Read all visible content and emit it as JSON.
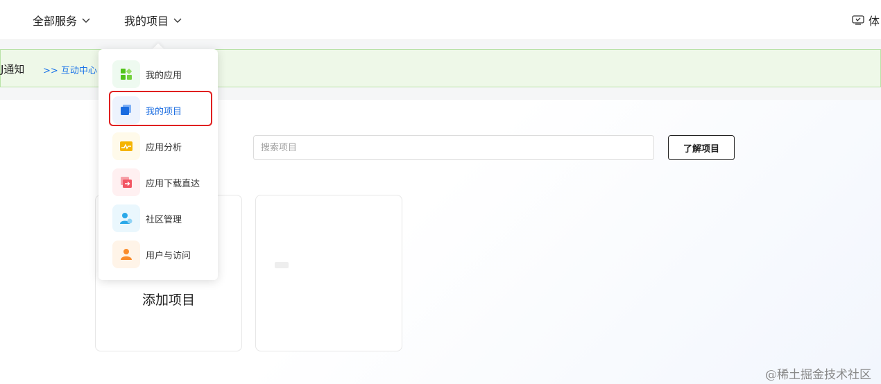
{
  "nav": {
    "all_services": "全部服务",
    "my_projects": "我的项目",
    "right_label": "体"
  },
  "notice": {
    "title": "J通知",
    "link": ">> 互动中心"
  },
  "search": {
    "placeholder": "搜索项目",
    "value": ""
  },
  "learn_button": "了解项目",
  "cards": {
    "add_label": "添加项目"
  },
  "dropdown": {
    "items": [
      {
        "label": "我的应用",
        "icon": "apps-grid-icon",
        "color": "#52c41a"
      },
      {
        "label": "我的项目",
        "icon": "project-stack-icon",
        "color": "#1a6ce0",
        "active": true
      },
      {
        "label": "应用分析",
        "icon": "analytics-chart-icon",
        "color": "#f5b400"
      },
      {
        "label": "应用下载直达",
        "icon": "download-direct-icon",
        "color": "#f25563"
      },
      {
        "label": "社区管理",
        "icon": "community-user-icon",
        "color": "#2aa8e8"
      },
      {
        "label": "用户与访问",
        "icon": "user-access-icon",
        "color": "#fa8c2b"
      }
    ]
  },
  "watermark": "@稀土掘金技术社区"
}
